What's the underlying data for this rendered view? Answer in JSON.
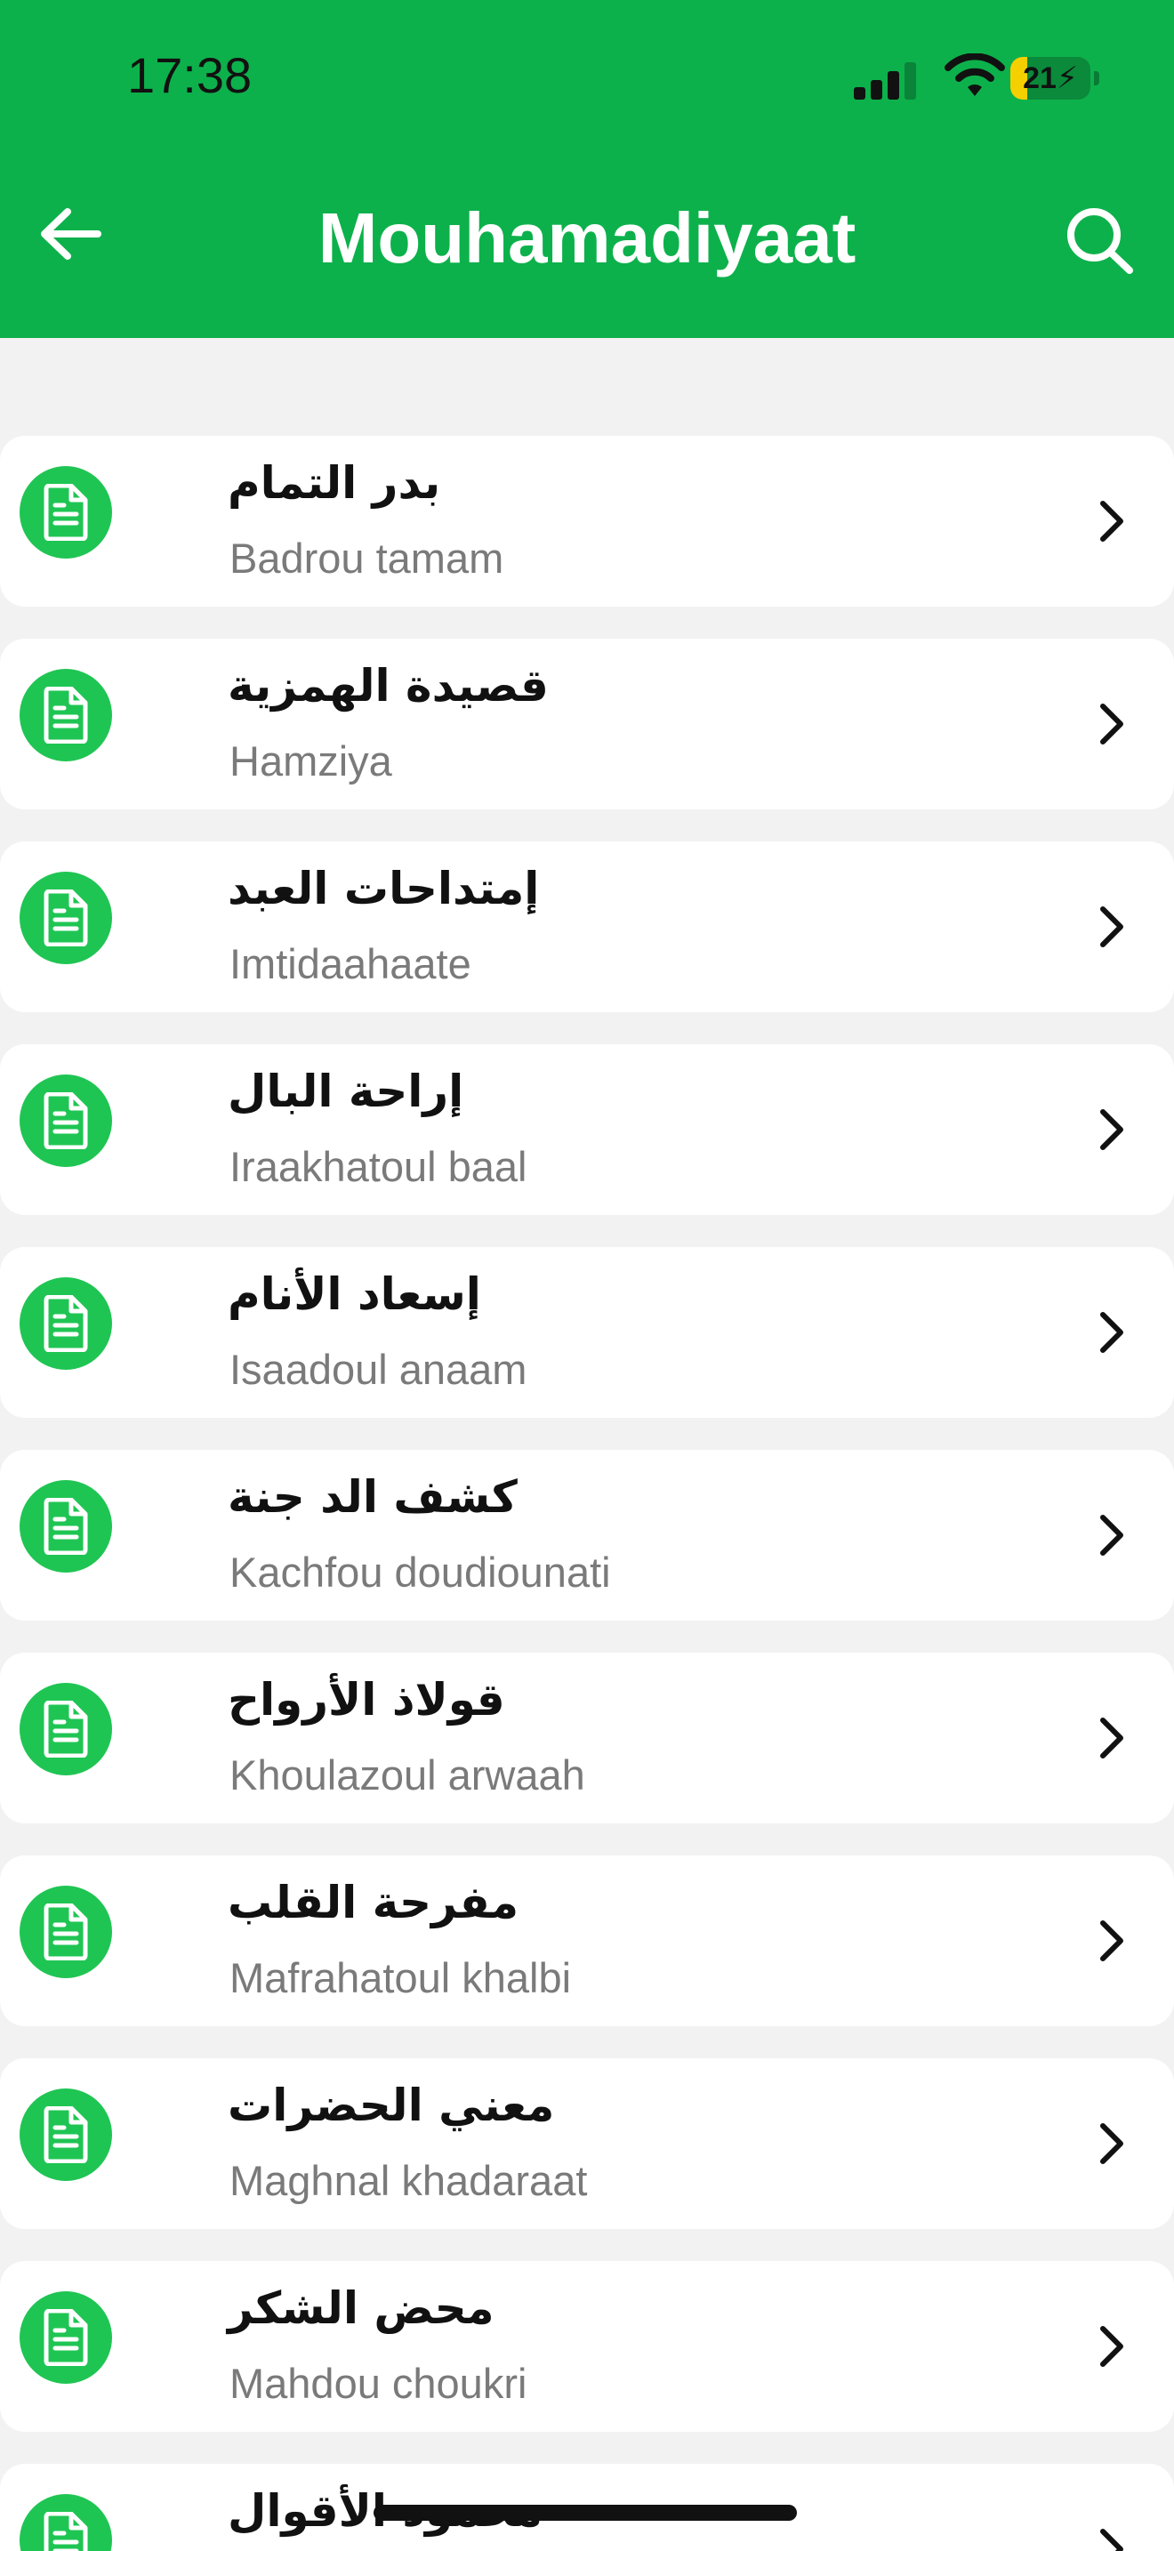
{
  "status_bar": {
    "time": "17:38",
    "battery": "21"
  },
  "header": {
    "title": "Mouhamadiyaat"
  },
  "colors": {
    "brand": "#0db14b",
    "icon_circle": "#1fc553",
    "background": "#f2f2f2"
  },
  "icons": {
    "back": "arrow-left-icon",
    "search": "search-icon",
    "item": "document-icon",
    "chevron": "chevron-right-icon"
  },
  "items": [
    {
      "arabic": "بدر التمام",
      "latin": "Badrou tamam"
    },
    {
      "arabic": "قصيدة الهمزية",
      "latin": "Hamziya"
    },
    {
      "arabic": "إمتداحات العبد",
      "latin": "Imtidaahaate"
    },
    {
      "arabic": "إراحة البال",
      "latin": "Iraakhatoul baal"
    },
    {
      "arabic": "إسعاد الأنام",
      "latin": "Isaadoul anaam"
    },
    {
      "arabic": "كشف الد جنة",
      "latin": "Kachfou doudiounati"
    },
    {
      "arabic": "قولاذ الأرواح",
      "latin": "Khoulazoul arwaah"
    },
    {
      "arabic": "مفرحة القلب",
      "latin": "Mafrahatoul khalbi"
    },
    {
      "arabic": "معني الحضرات",
      "latin": "Maghnal khadaraat"
    },
    {
      "arabic": "محض الشكر",
      "latin": "Mahdou choukri"
    },
    {
      "arabic": "محمود الأقوال",
      "latin": ""
    }
  ]
}
